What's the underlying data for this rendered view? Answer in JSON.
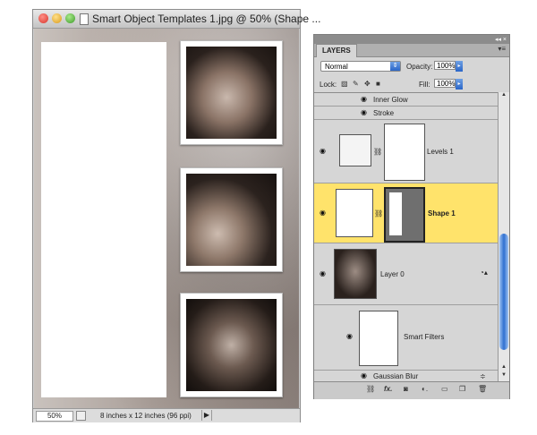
{
  "document": {
    "title": "Smart Object Templates 1.jpg @ 50% (Shape ...",
    "zoom": "50%",
    "doc_size": "8 inches x 12 inches (96 ppi)"
  },
  "layers_panel": {
    "tab_label": "LAYERS",
    "blend_mode": "Normal",
    "opacity_label": "Opacity:",
    "opacity_value": "100%",
    "lock_label": "Lock:",
    "fill_label": "Fill:",
    "fill_value": "100%",
    "rows": [
      {
        "name": "Inner Glow"
      },
      {
        "name": "Stroke"
      },
      {
        "name": "Levels 1"
      },
      {
        "name": "Shape 1"
      },
      {
        "name": "Layer 0"
      },
      {
        "name": "Smart Filters"
      },
      {
        "name": "Gaussian Blur"
      }
    ]
  },
  "colors": {
    "selected_row": "#ffe36b",
    "accent": "#2a66c8"
  }
}
